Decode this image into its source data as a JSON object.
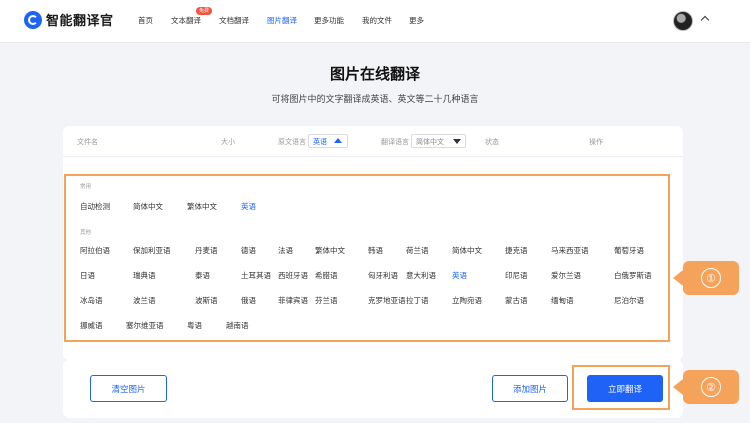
{
  "app": {
    "brand": "智能翻译官"
  },
  "nav": {
    "items": [
      "首页",
      "文本翻译",
      "文档翻译",
      "图片翻译",
      "更多功能",
      "我的文件",
      "更多"
    ],
    "active_index": 3,
    "badge": "免费"
  },
  "page": {
    "title": "图片在线翻译",
    "subtitle": "可将图片中的文字翻译成英语、英文等二十几种语言"
  },
  "table_header": {
    "filename": "文件名",
    "size": "大小",
    "source_lang_label": "原文语言",
    "source_lang_value": "英语",
    "target_lang_label": "翻译语言",
    "target_lang_value": "简体中文",
    "status": "状态",
    "action": "操作"
  },
  "lang_picker": {
    "common_label": "常用",
    "common": [
      "自动检测",
      "简体中文",
      "繁体中文",
      "英语"
    ],
    "common_selected_index": 3,
    "other_label": "其他",
    "other_rows": [
      [
        "阿拉伯语",
        "保加利亚语",
        "丹麦语",
        "德语",
        "法语",
        "繁体中文",
        "韩语",
        "荷兰语",
        "简体中文",
        "捷克语",
        "马来西亚语",
        "葡萄牙语"
      ],
      [
        "日语",
        "瑞典语",
        "泰语",
        "土耳其语",
        "西班牙语",
        "希腊语",
        "匈牙利语",
        "意大利语",
        "英语",
        "印尼语",
        "爱尔兰语",
        "白俄罗斯语"
      ],
      [
        "冰岛语",
        "波兰语",
        "波斯语",
        "俄语",
        "菲律宾语",
        "芬兰语",
        "克罗地亚语",
        "拉丁语",
        "立陶宛语",
        "蒙古语",
        "缅甸语",
        "尼泊尔语"
      ],
      [
        "挪威语",
        "塞尔维亚语",
        "粤语",
        "越南语"
      ]
    ],
    "other_selected": "英语"
  },
  "buttons": {
    "clear": "清空图片",
    "add": "添加图片",
    "translate": "立即翻译"
  },
  "callouts": {
    "one": "①",
    "two": "②"
  },
  "colors": {
    "accent": "#1e63f5",
    "highlight": "#f5a35b"
  }
}
